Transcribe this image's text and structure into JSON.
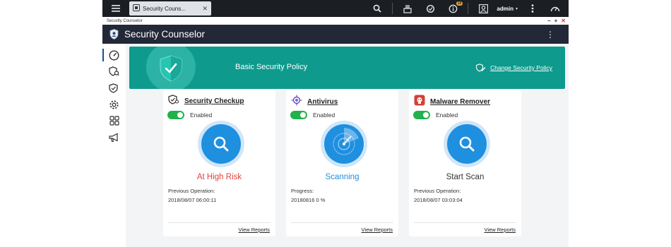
{
  "sysbar": {
    "tab_title": "Security Couns...",
    "tab_close": "✕",
    "notification_count": "10",
    "username": "admin",
    "caret": "▾"
  },
  "window": {
    "title": "Security Counselor",
    "controls": [
      "−",
      "+",
      "✕"
    ]
  },
  "app": {
    "title": "Security Counselor",
    "more": "⋮"
  },
  "banner": {
    "title": "Basic Security Policy",
    "link": "Change Security Policy"
  },
  "cards": [
    {
      "title": "Security Checkup",
      "toggle": "Enabled",
      "status": "At High Risk",
      "status_color": "#e5413b",
      "meta_label": "Previous Operation:",
      "meta_value": "2018/08/07 06:00:11",
      "link": "View Reports"
    },
    {
      "title": "Antivirus",
      "toggle": "Enabled",
      "status": "Scanning",
      "status_color": "#1f8fe0",
      "meta_label": "Progress:",
      "meta_value": "20180816 0 %",
      "link": "View Reports"
    },
    {
      "title": "Malware Remover",
      "toggle": "Enabled",
      "status": "Start Scan",
      "status_color": "#333333",
      "meta_label": "Previous Operation:",
      "meta_value": "2018/08/07 03:03:04",
      "link": "View Reports"
    }
  ],
  "colors": {
    "banner": "#0e9a8d",
    "header": "#232838",
    "accent": "#1f8fe0",
    "toggle_on": "#22b14c"
  },
  "icons": {
    "rail": [
      "dashboard-icon",
      "security-checkup-icon",
      "shield-icon",
      "gear-icon",
      "apps-icon",
      "megaphone-icon"
    ]
  }
}
